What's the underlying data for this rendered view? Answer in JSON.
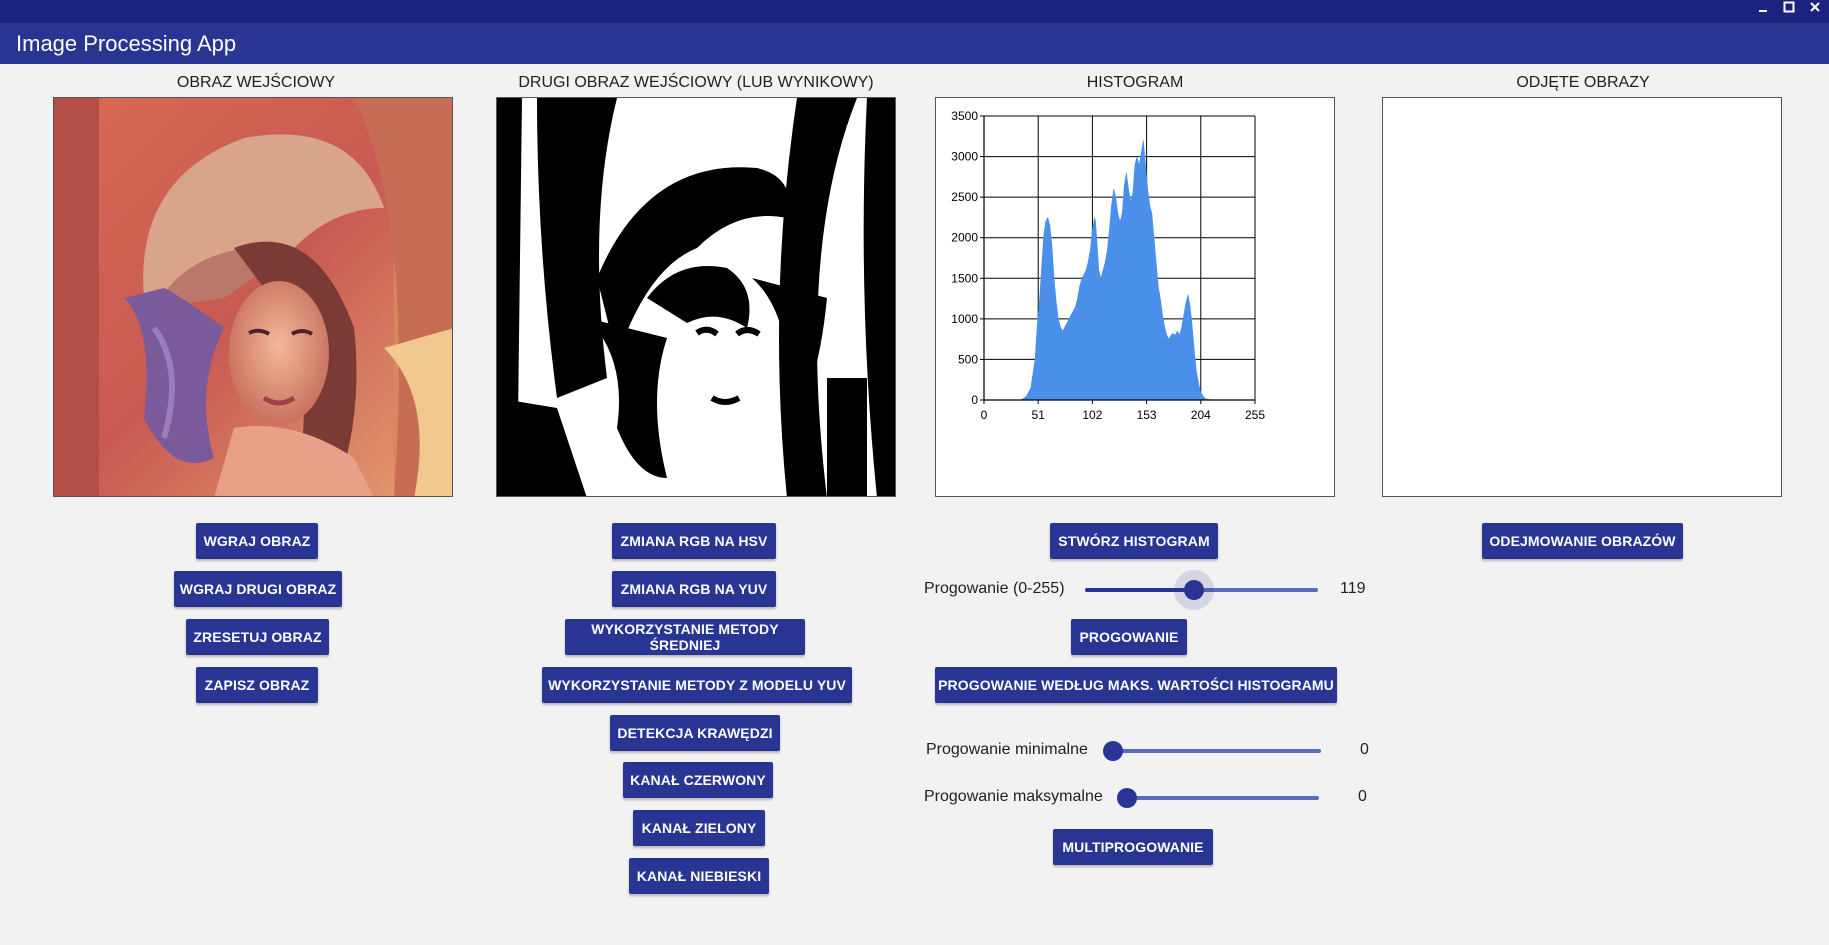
{
  "window": {
    "title": "Image Processing App",
    "controls": [
      "minimize-icon",
      "maximize-icon",
      "close-icon"
    ]
  },
  "panels": {
    "input": {
      "label": "OBRAZ WEJŚCIOWY"
    },
    "second": {
      "label": "DRUGI OBRAZ WEJŚCIOWY (LUB WYNIKOWY)"
    },
    "histogram": {
      "label": "HISTOGRAM"
    },
    "subtracted": {
      "label": "ODJĘTE OBRAZY"
    }
  },
  "buttons_col1": [
    "WGRAJ OBRAZ",
    "WGRAJ DRUGI OBRAZ",
    "ZRESETUJ OBRAZ",
    "ZAPISZ OBRAZ"
  ],
  "buttons_col2": [
    "ZMIANA RGB NA HSV",
    "ZMIANA RGB NA YUV",
    "WYKORZYSTANIE METODY ŚREDNIEJ",
    "WYKORZYSTANIE METODY Z MODELU YUV",
    "DETEKCJA KRAWĘDZI",
    "KANAŁ CZERWONY",
    "KANAŁ ZIELONY",
    "KANAŁ NIEBIESKI"
  ],
  "buttons_col3": {
    "create_histogram": "STWÓRZ HISTOGRAM",
    "threshold": "PROGOWANIE",
    "threshold_max": "PROGOWANIE WEDŁUG MAKS. WARTOŚCI HISTOGRAMU",
    "multithreshold": "MULTIPROGOWANIE"
  },
  "buttons_col4": {
    "subtract": "ODEJMOWANIE OBRAZÓW"
  },
  "sliders": {
    "threshold": {
      "label": "Progowanie (0-255)",
      "value": "119",
      "fraction": 0.467
    },
    "min": {
      "label": "Progowanie minimalne",
      "value": "0",
      "fraction": 0
    },
    "max": {
      "label": "Progowanie maksymalne",
      "value": "0",
      "fraction": 0
    }
  },
  "colors": {
    "primary": "#283593",
    "titlebar": "#283593",
    "chromebar": "#1a237e",
    "histogram_fill": "#4a8fea"
  },
  "chart_data": {
    "type": "area",
    "x_ticks": [
      "0",
      "51",
      "102",
      "153",
      "204",
      "255"
    ],
    "y_ticks": [
      "0",
      "500",
      "1000",
      "1500",
      "2000",
      "2500",
      "3000",
      "3500"
    ],
    "xlim": [
      0,
      255
    ],
    "ylim": [
      0,
      3500
    ],
    "grid": true,
    "series": [
      {
        "x": [
          35,
          40,
          44,
          48,
          50,
          52,
          54,
          56,
          58,
          60,
          62,
          64,
          66,
          68,
          70,
          72,
          74,
          76,
          78,
          80,
          82,
          84,
          86,
          88,
          90,
          92,
          94,
          96,
          98,
          100,
          102,
          104,
          105,
          106,
          108,
          110,
          112,
          114,
          116,
          118,
          120,
          122,
          124,
          126,
          128,
          130,
          132,
          134,
          136,
          138,
          140,
          142,
          144,
          146,
          148,
          150,
          152,
          154,
          156,
          158,
          160,
          162,
          164,
          166,
          168,
          170,
          172,
          174,
          176,
          178,
          180,
          182,
          184,
          186,
          188,
          190,
          192,
          194,
          196,
          198,
          200,
          202,
          204,
          206,
          208,
          210,
          212,
          214,
          216,
          218,
          220,
          225,
          230,
          235
        ],
        "y": [
          0,
          50,
          150,
          500,
          900,
          1200,
          1600,
          2000,
          2200,
          2250,
          2150,
          1900,
          1500,
          1200,
          1000,
          900,
          850,
          900,
          950,
          1000,
          1050,
          1100,
          1150,
          1250,
          1400,
          1500,
          1550,
          1600,
          1700,
          1850,
          2100,
          2250,
          2200,
          2000,
          1600,
          1500,
          1600,
          1700,
          1850,
          2100,
          2400,
          2600,
          2500,
          2300,
          2200,
          2300,
          2650,
          2800,
          2600,
          2450,
          2550,
          2900,
          3000,
          2900,
          3050,
          3200,
          2900,
          2600,
          2400,
          2300,
          2000,
          1700,
          1400,
          1250,
          1050,
          900,
          800,
          750,
          800,
          820,
          800,
          850,
          800,
          900,
          1050,
          1200,
          1300,
          1150,
          900,
          600,
          350,
          200,
          100,
          50,
          20,
          10,
          5,
          0,
          0,
          0,
          0,
          0,
          0,
          0
        ]
      }
    ]
  }
}
